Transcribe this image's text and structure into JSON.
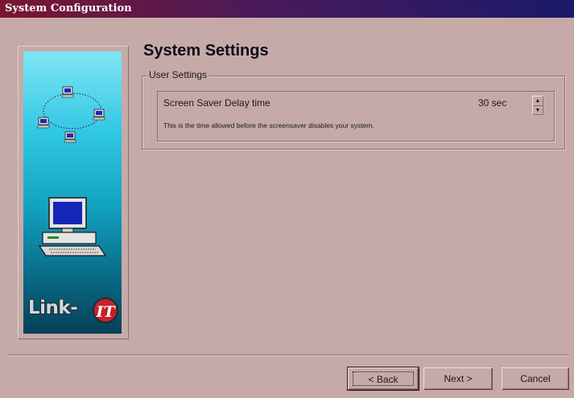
{
  "window": {
    "title": "System Configuration"
  },
  "sidebar": {
    "logo_text": "Link-",
    "logo_badge": "IT",
    "icons": [
      "network-computers-icon",
      "desktop-computer-icon"
    ]
  },
  "main": {
    "title": "System Settings",
    "group": {
      "legend": "User Settings",
      "setting": {
        "label": "Screen Saver Delay time",
        "value": "30 sec",
        "description": "This is the time allowed before the screensaver disables your system."
      }
    }
  },
  "buttons": {
    "back": "< Back",
    "next": "Next >",
    "cancel": "Cancel"
  },
  "colors": {
    "background": "#c6aaa8",
    "titlebar_start": "#7a1630",
    "titlebar_end": "#1a1a6a",
    "logo_red": "#c8202a"
  }
}
